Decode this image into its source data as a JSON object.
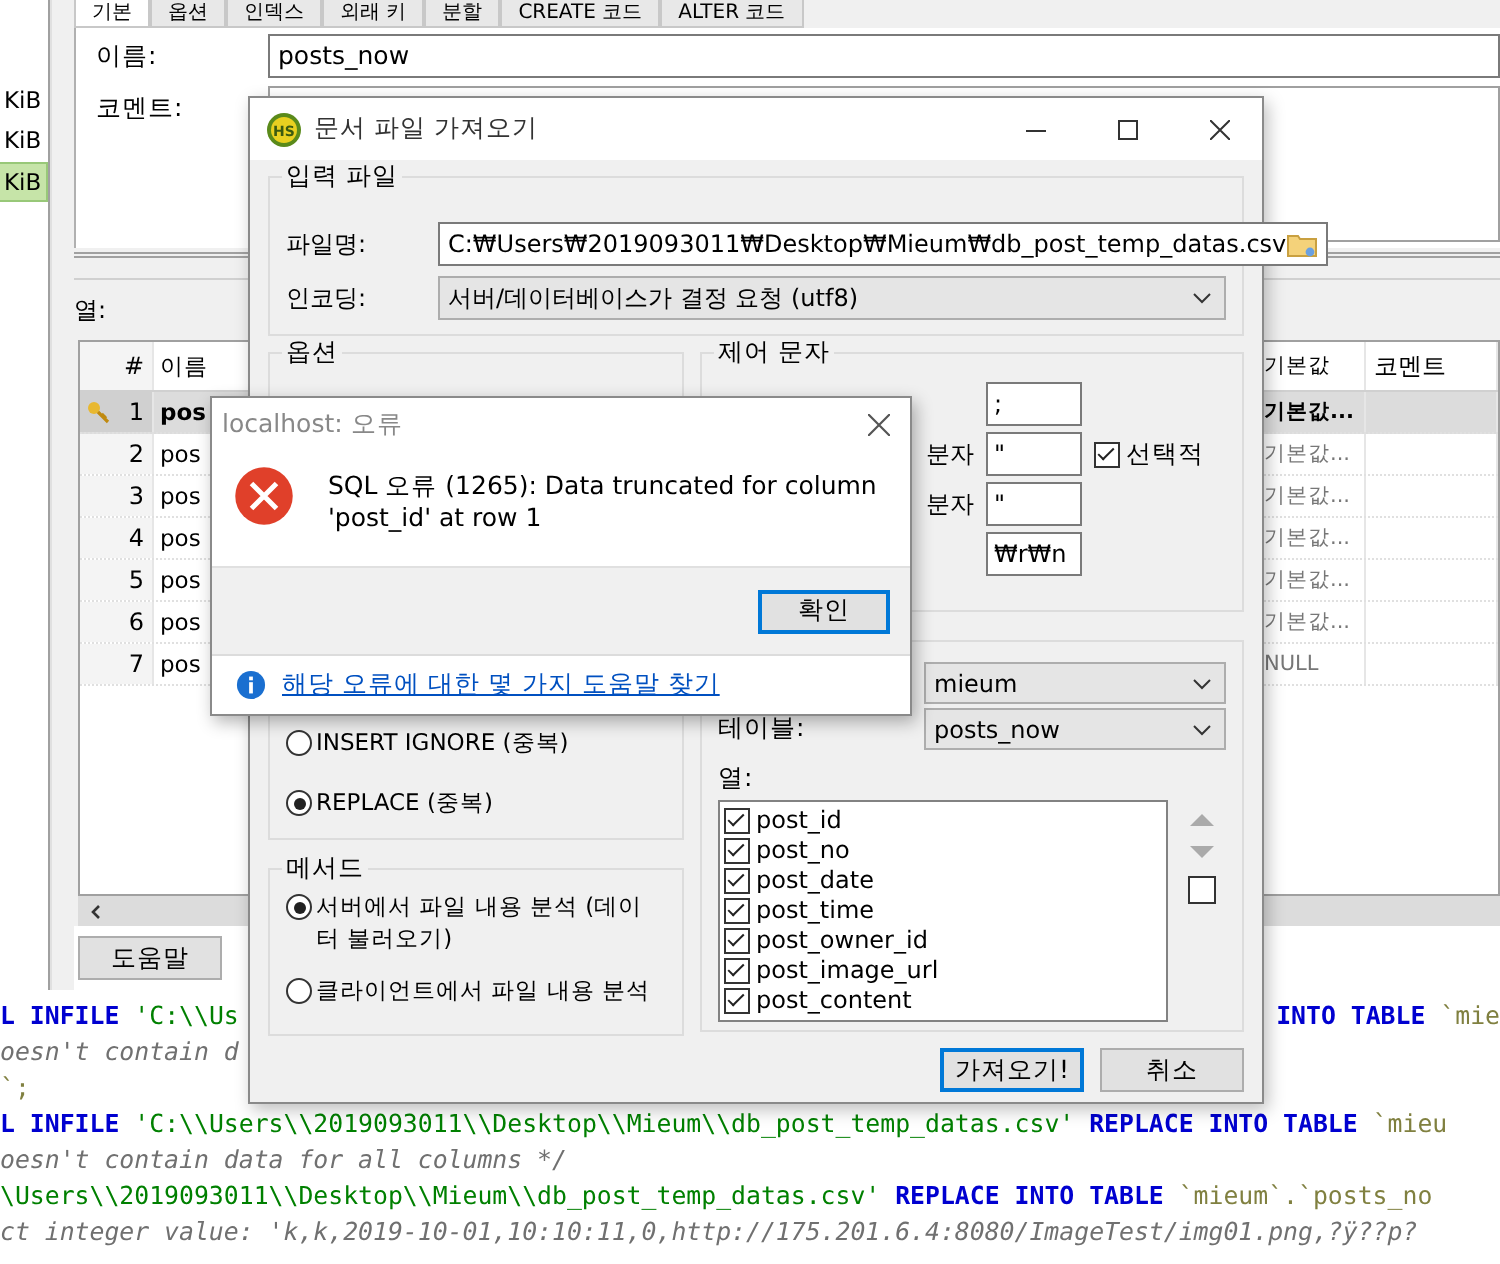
{
  "sidebar": {
    "items": [
      {
        "label": "KiB",
        "selected": false
      },
      {
        "label": "KiB",
        "selected": false
      },
      {
        "label": "KiB",
        "selected": true
      }
    ]
  },
  "tabs": [
    {
      "label": "기본",
      "selected": true
    },
    {
      "label": "옵션",
      "selected": false
    },
    {
      "label": "인덱스",
      "selected": false
    },
    {
      "label": "외래 키",
      "selected": false
    },
    {
      "label": "분할",
      "selected": false
    },
    {
      "label": "CREATE 코드",
      "selected": false
    },
    {
      "label": "ALTER 코드",
      "selected": false
    }
  ],
  "form": {
    "name_label": "이름:",
    "name_value": "posts_now",
    "comment_label": "코멘트:"
  },
  "columns_label": "열:",
  "table": {
    "columns": [
      "#",
      "이름",
      "기본값",
      "코멘트"
    ],
    "rows": [
      {
        "num": "1",
        "name": "pos",
        "default": "기본값...",
        "key": true,
        "selected": true
      },
      {
        "num": "2",
        "name": "pos",
        "default": "기본값...",
        "key": false,
        "selected": false
      },
      {
        "num": "3",
        "name": "pos",
        "default": "기본값...",
        "key": false,
        "selected": false
      },
      {
        "num": "4",
        "name": "pos",
        "default": "기본값...",
        "key": false,
        "selected": false
      },
      {
        "num": "5",
        "name": "pos",
        "default": "기본값...",
        "key": false,
        "selected": false
      },
      {
        "num": "6",
        "name": "pos",
        "default": "기본값...",
        "key": false,
        "selected": false
      },
      {
        "num": "7",
        "name": "pos",
        "default": "NULL",
        "key": false,
        "selected": false
      }
    ]
  },
  "help_button": "도움말",
  "log": [
    {
      "left": [
        {
          "text": "L INFILE",
          "kind": "keyword"
        },
        {
          "text": " 'C:\\\\Us",
          "kind": "string"
        }
      ],
      "right": [
        {
          "text": "INTO TABLE",
          "kind": "keyword"
        },
        {
          "text": " `mie",
          "kind": "ident"
        }
      ]
    },
    {
      "left": [
        {
          "text": "oesn't contain d",
          "kind": "comment"
        }
      ]
    },
    {
      "left": [
        {
          "text": "`;",
          "kind": "ident"
        }
      ]
    },
    {
      "left": [
        {
          "text": "L INFILE",
          "kind": "keyword"
        },
        {
          "text": " 'C:\\\\Users\\\\2019093011\\\\Desktop\\\\Mieum\\\\db_post_temp_datas.csv' ",
          "kind": "string"
        },
        {
          "text": "REPLACE INTO TABLE",
          "kind": "keyword"
        },
        {
          "text": " `mieu",
          "kind": "ident"
        }
      ]
    },
    {
      "left": [
        {
          "text": "oesn't contain data for all columns */",
          "kind": "comment"
        }
      ]
    },
    {
      "left": [
        {
          "text": "\\Users\\\\2019093011\\\\Desktop\\\\Mieum\\\\db_post_temp_datas.csv' ",
          "kind": "string"
        },
        {
          "text": "REPLACE INTO TABLE",
          "kind": "keyword"
        },
        {
          "text": " `mieum`.`posts_no",
          "kind": "ident"
        }
      ]
    },
    {
      "left": [
        {
          "text": "ct integer value: 'k,k,2019-10-01,10:10:11,0,http://175.201.6.4:8080/ImageTest/img01.png,?ÿ??p?",
          "kind": "comment"
        }
      ]
    }
  ],
  "import_dialog": {
    "logo_text": "HS",
    "title": "문서 파일 가져오기",
    "input_group": {
      "title": "입력 파일",
      "file_label": "파일명:",
      "file_value": "C:₩Users₩2019093011₩Desktop₩Mieum₩db_post_temp_datas.csv",
      "encoding_label": "인코딩:",
      "encoding_value": "서버/데이터베이스가 결정 요청 (utf8)"
    },
    "options_group": {
      "title": "옵션",
      "radios": [
        {
          "label": "INSERT IGNORE (중복)",
          "selected": false
        },
        {
          "label": "REPLACE (중복)",
          "selected": true
        }
      ]
    },
    "control_group": {
      "title": "제어 문자",
      "rows": [
        {
          "value": ";"
        },
        {
          "label": "분자",
          "value": "\"",
          "option": {
            "label": "선택적",
            "checked": true
          }
        },
        {
          "label": "분자",
          "value": "\""
        },
        {
          "value": "₩r₩n"
        }
      ]
    },
    "target_group": {
      "database_value": "mieum",
      "table_label": "테이블:",
      "table_value": "posts_now",
      "columns_label": "열:",
      "columns": [
        {
          "label": "post_id",
          "checked": true
        },
        {
          "label": "post_no",
          "checked": true
        },
        {
          "label": "post_date",
          "checked": true
        },
        {
          "label": "post_time",
          "checked": true
        },
        {
          "label": "post_owner_id",
          "checked": true
        },
        {
          "label": "post_image_url",
          "checked": true
        },
        {
          "label": "post_content",
          "checked": true
        }
      ],
      "select_all_checked": false
    },
    "method_group": {
      "title": "메서드",
      "radios": [
        {
          "label": "서버에서 파일 내용 분석 (데이터 불러오기)",
          "selected": true
        },
        {
          "label": "클라이언트에서 파일 내용 분석",
          "selected": false
        }
      ]
    },
    "buttons": [
      {
        "label": "가져오기!",
        "default": true
      },
      {
        "label": "취소",
        "default": false
      }
    ]
  },
  "error_dialog": {
    "title": "localhost: 오류",
    "message": "SQL 오류 (1265): Data truncated for column 'post_id' at row 1",
    "ok_button": "확인",
    "help_link": "해당 오류에 대한 몇 가지 도움말 찾기"
  }
}
